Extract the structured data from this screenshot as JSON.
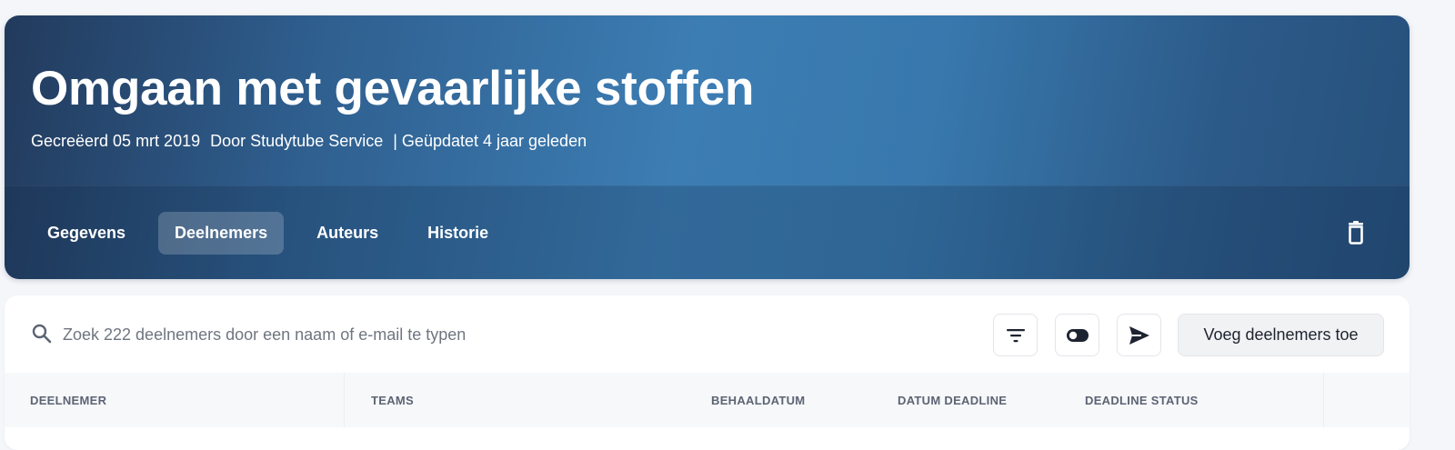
{
  "hero": {
    "title": "Omgaan met gevaarlijke stoffen",
    "created": "Gecreëerd 05 mrt 2019",
    "author": "Door Studytube Service",
    "updated": "| Geüpdatet 4 jaar geleden"
  },
  "tabs": [
    {
      "label": "Gegevens",
      "active": false
    },
    {
      "label": "Deelnemers",
      "active": true
    },
    {
      "label": "Auteurs",
      "active": false
    },
    {
      "label": "Historie",
      "active": false
    }
  ],
  "toolbar": {
    "search_placeholder": "Zoek 222 deelnemers door een naam of e-mail te typen",
    "add_label": "Voeg deelnemers toe",
    "icons": [
      "filter-icon",
      "toggle-icon",
      "send-icon"
    ]
  },
  "table": {
    "columns": [
      "DEELNEMER",
      "TEAMS",
      "BEHAALDATUM",
      "DATUM DEADLINE",
      "DEADLINE STATUS"
    ]
  },
  "colors": {
    "hero_dark": "#223a5c",
    "hero_light": "#3c7db3",
    "text_dark": "#1d2330"
  }
}
